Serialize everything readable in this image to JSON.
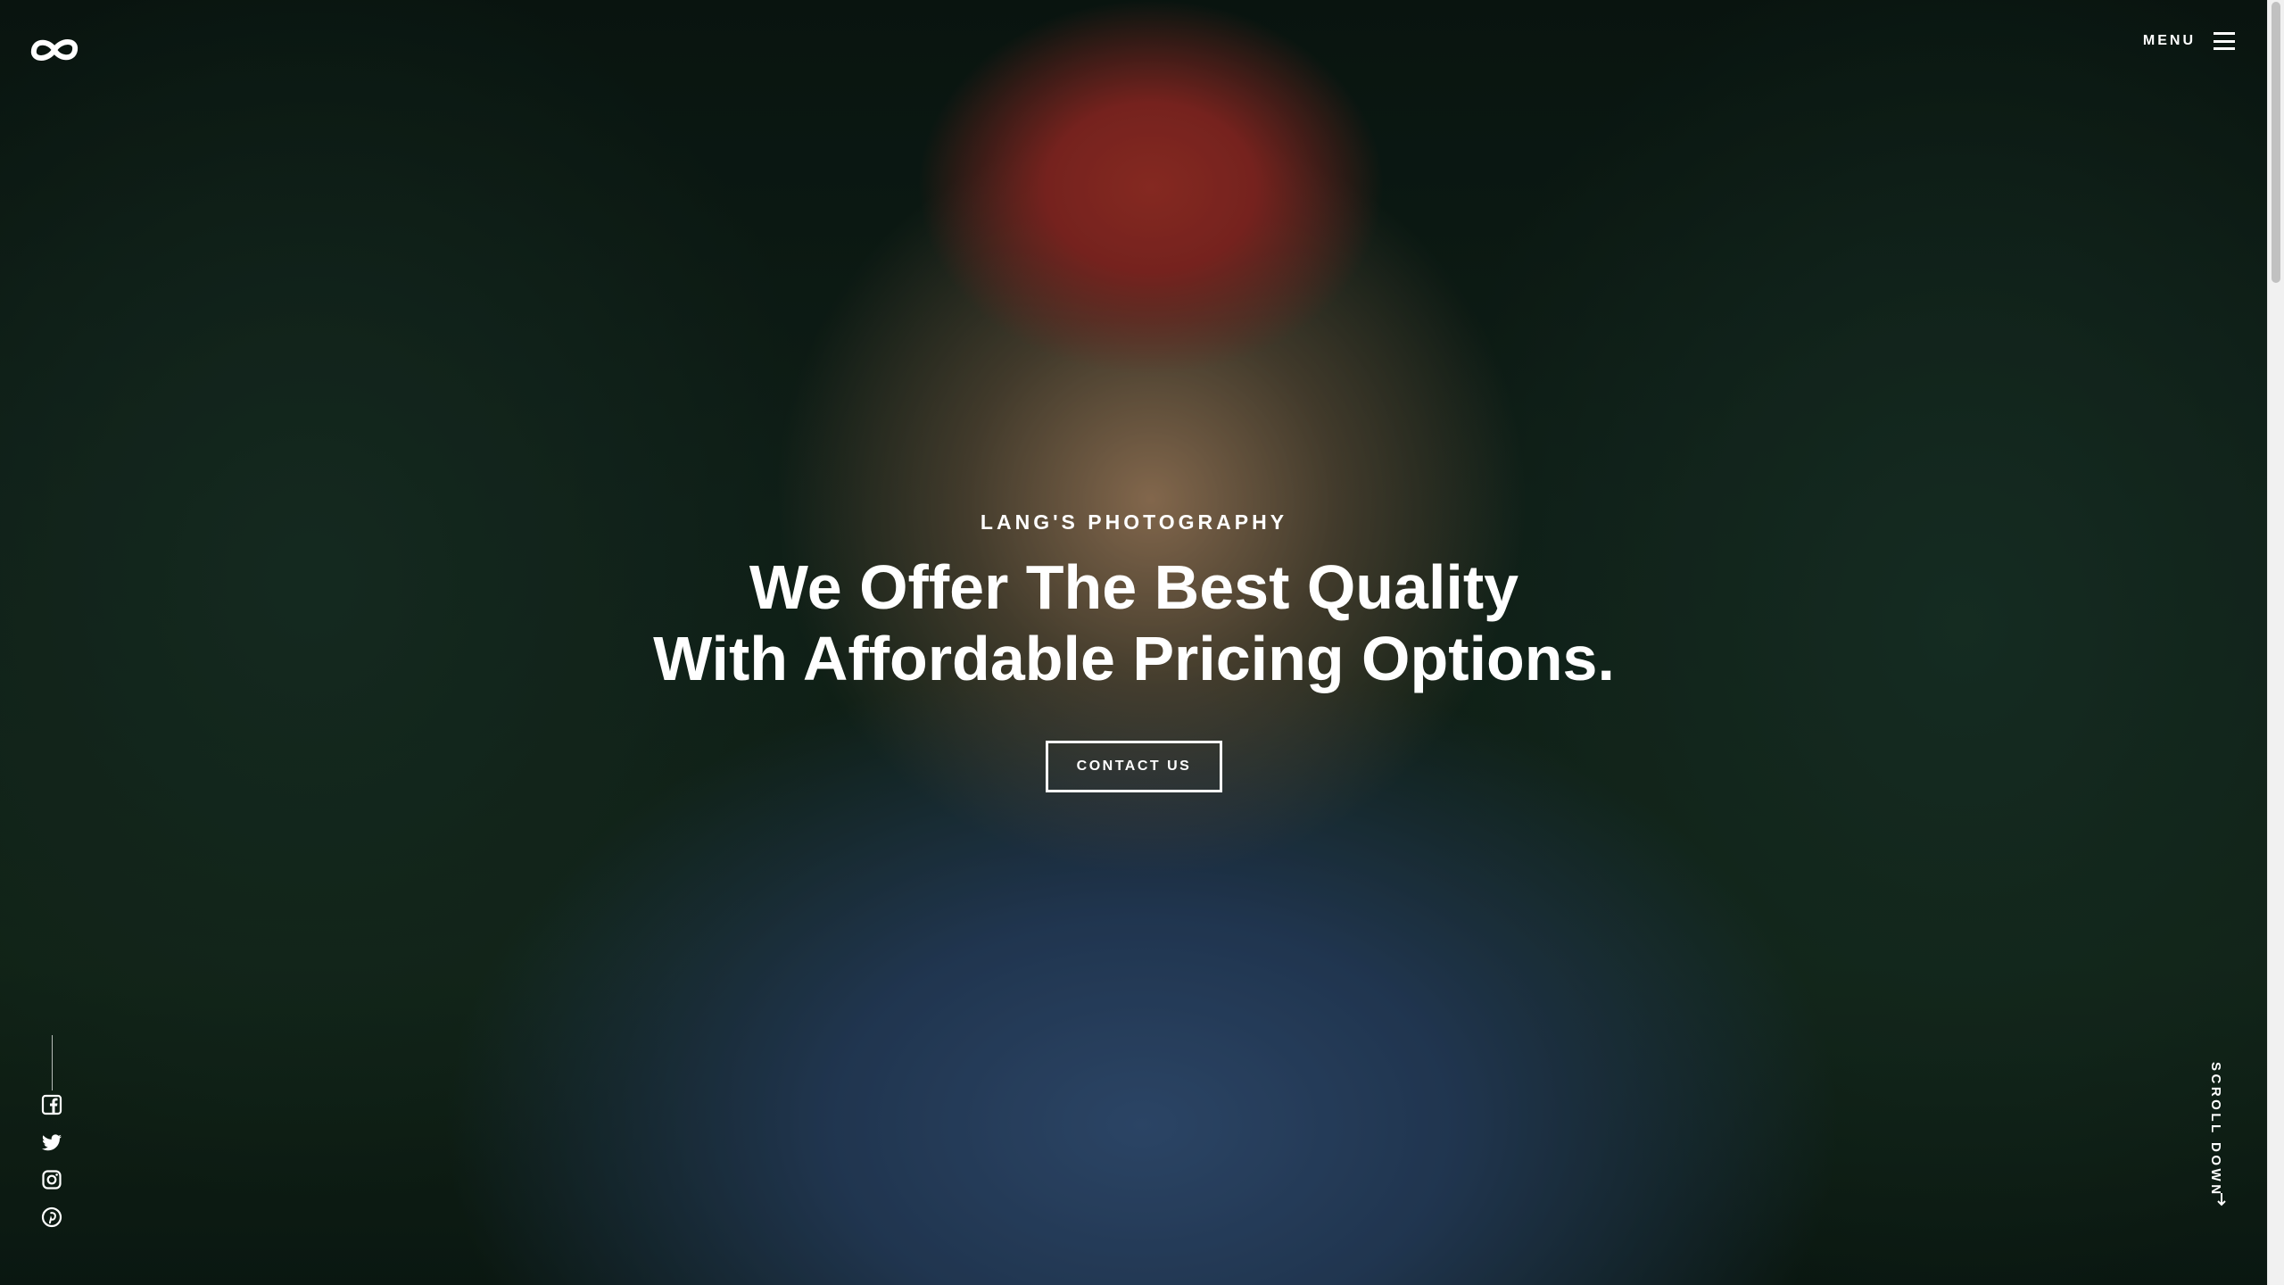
{
  "brand": {
    "logo_icon": "infinity-icon"
  },
  "header": {
    "menu_label": "MENU",
    "menu_icon": "hamburger-icon"
  },
  "hero": {
    "kicker": "LANG'S PHOTOGRAPHY",
    "headline_line1": "We Offer The Best Quality",
    "headline_line2": "With Affordable Pricing Options.",
    "cta_label": "CONTACT US"
  },
  "social": [
    {
      "name": "facebook",
      "icon": "facebook-icon"
    },
    {
      "name": "twitter",
      "icon": "twitter-icon"
    },
    {
      "name": "instagram",
      "icon": "instagram-icon"
    },
    {
      "name": "pinterest",
      "icon": "pinterest-icon"
    }
  ],
  "scroll_hint": {
    "label": "SCROLL DOWN",
    "icon": "arrow-down-icon"
  },
  "colors": {
    "text": "#ffffff",
    "button_border": "#ffffff",
    "scrollbar_track": "#f1f1f1",
    "scrollbar_thumb": "#c1c1c1"
  }
}
